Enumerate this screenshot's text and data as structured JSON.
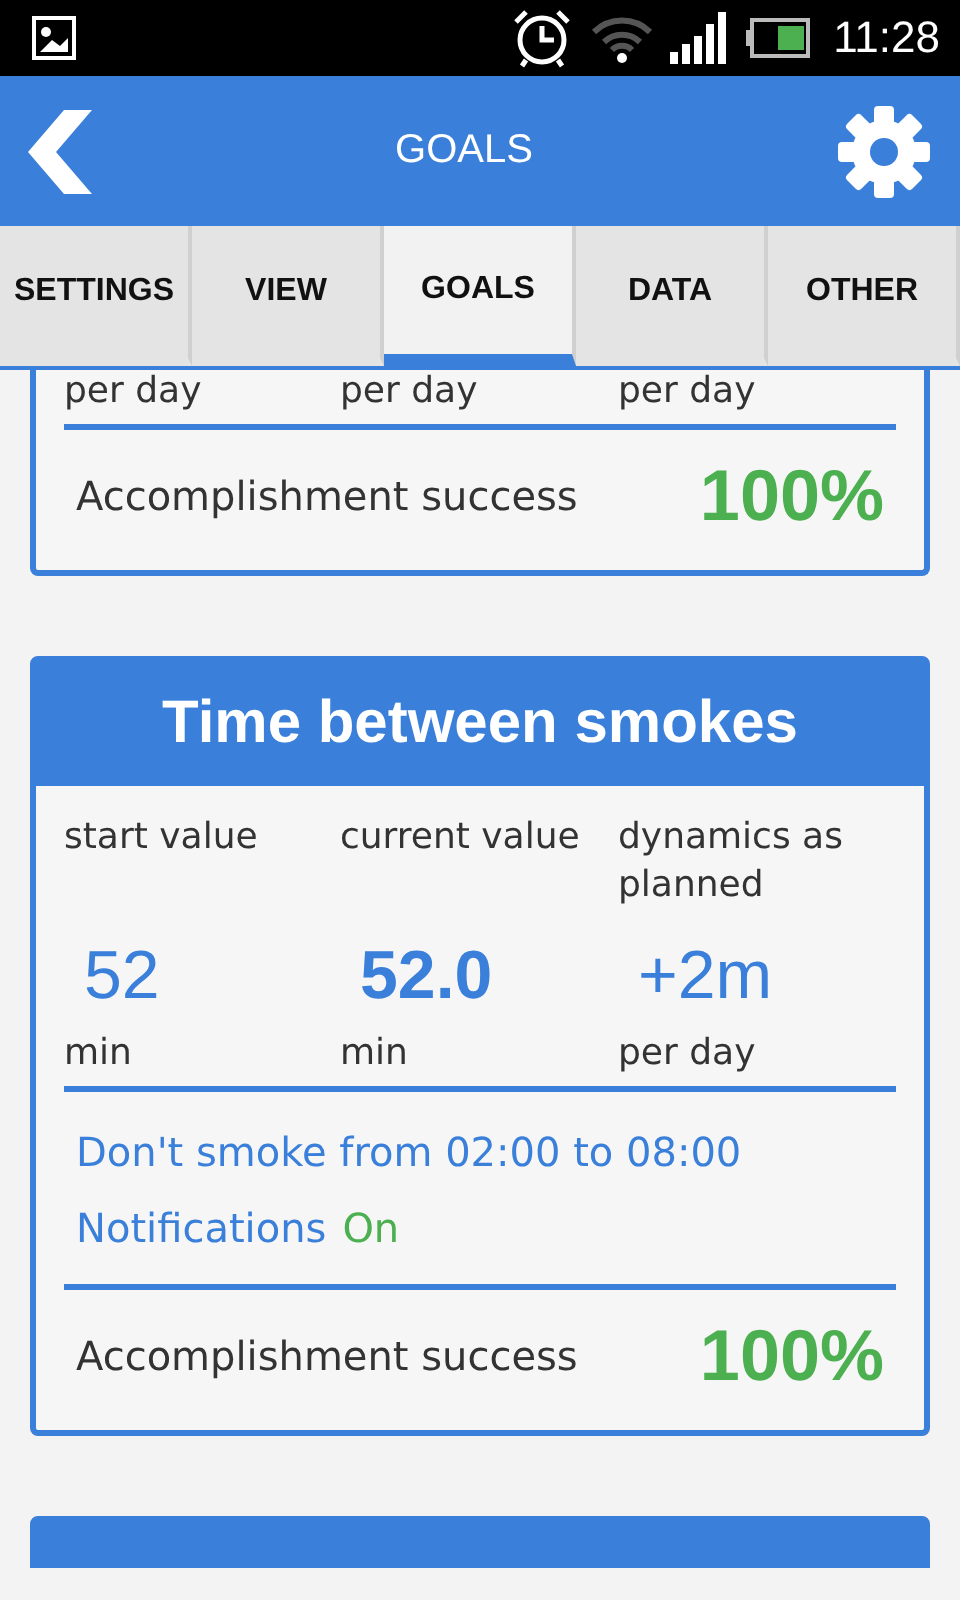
{
  "status_bar": {
    "time": "11:28"
  },
  "app_bar": {
    "title": "GOALS"
  },
  "tabs": [
    {
      "label": "SETTINGS",
      "selected": false
    },
    {
      "label": "VIEW",
      "selected": false
    },
    {
      "label": "GOALS",
      "selected": true
    },
    {
      "label": "DATA",
      "selected": false
    },
    {
      "label": "OTHER",
      "selected": false
    }
  ],
  "goals": [
    {
      "kind": "partial",
      "columns": [
        {
          "unit": "per day"
        },
        {
          "unit": "per day"
        },
        {
          "unit": "per day"
        }
      ],
      "success_label": "Accomplishment success",
      "success_value": "100%"
    },
    {
      "kind": "full",
      "title": "Time between smokes",
      "columns": [
        {
          "kind": "start",
          "label": "start value",
          "value": "52",
          "unit": "min"
        },
        {
          "kind": "current",
          "label": "current value",
          "value": "52.0",
          "unit": "min"
        },
        {
          "kind": "dynamics",
          "label": "dynamics as planned",
          "value": "+2m",
          "unit": "per day"
        }
      ],
      "schedule": "Don't smoke from 02:00 to 08:00",
      "notifications": {
        "label": "Notifications",
        "value": "On",
        "on": true
      },
      "success_label": "Accomplishment success",
      "success_value": "100%"
    },
    {
      "kind": "header_only"
    }
  ]
}
